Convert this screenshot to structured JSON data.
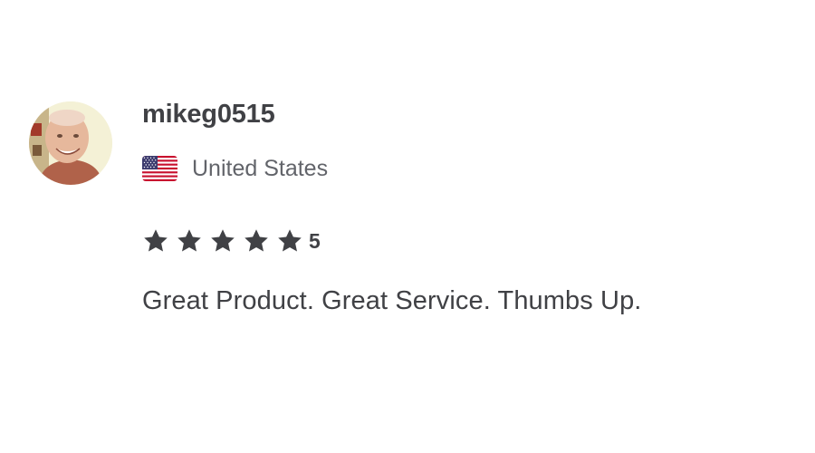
{
  "review": {
    "username": "mikeg0515",
    "country": "United States",
    "rating": {
      "stars_filled": 5,
      "stars_total": 5,
      "value_label": "5"
    },
    "text": "Great Product. Great Service. Thumbs Up."
  },
  "icons": {
    "avatar": "avatar-photo",
    "flag": "us-flag-icon",
    "star": "star-icon"
  },
  "colors": {
    "text_primary": "#404145",
    "text_secondary": "#62646a",
    "star": "#404145"
  }
}
